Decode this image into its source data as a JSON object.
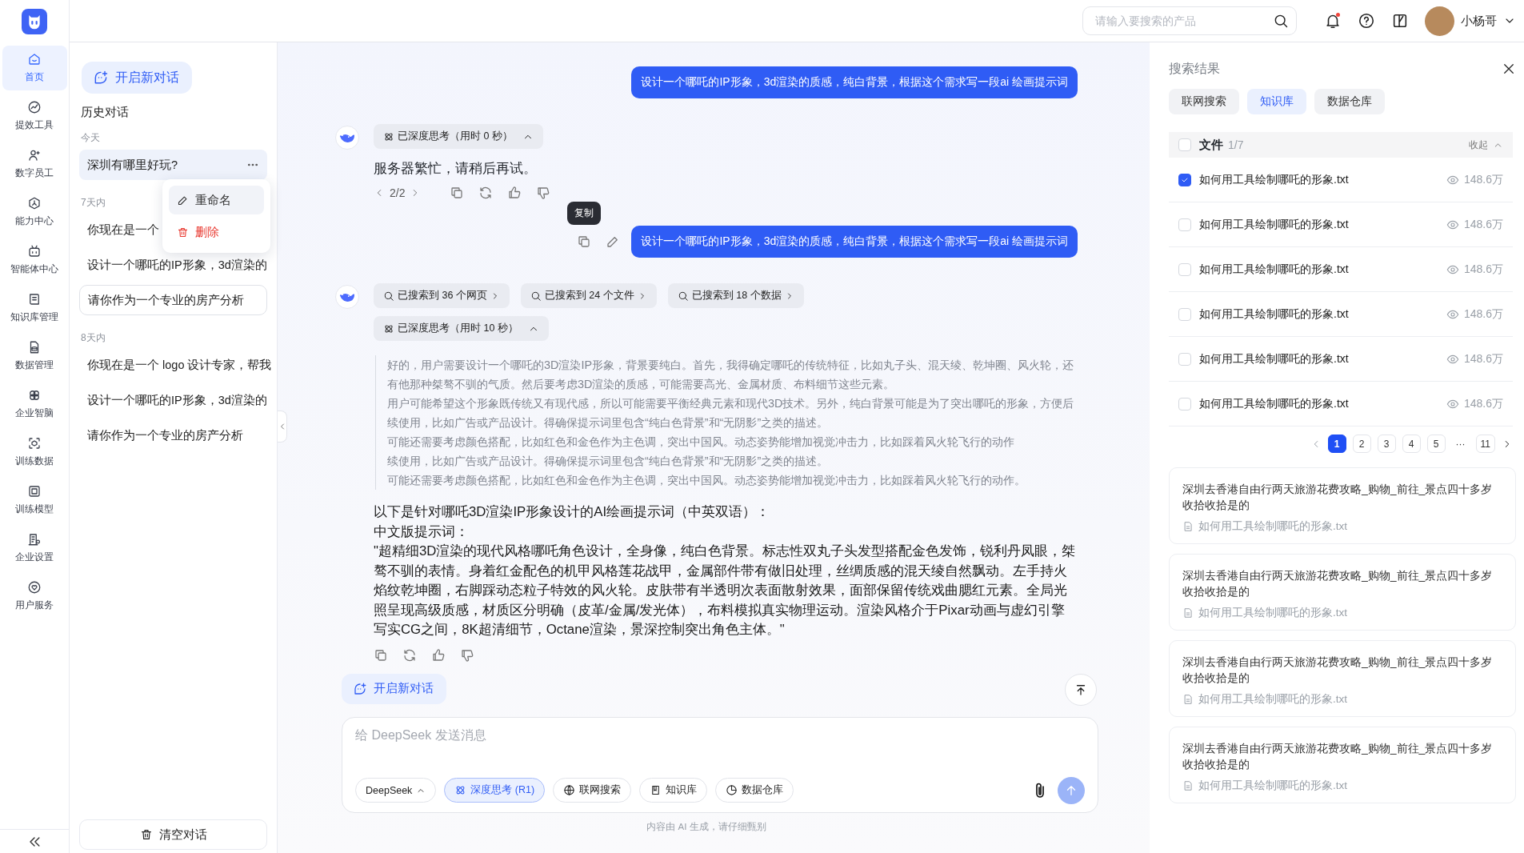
{
  "nav": {
    "items": [
      {
        "label": "首页",
        "selected": true
      },
      {
        "label": "提效工具",
        "selected": false
      },
      {
        "label": "数字员工",
        "selected": false
      },
      {
        "label": "能力中心",
        "selected": false
      },
      {
        "label": "智能体中心",
        "selected": false
      },
      {
        "label": "知识库管理",
        "selected": false
      },
      {
        "label": "数据管理",
        "selected": false
      },
      {
        "label": "企业智脑",
        "selected": false
      },
      {
        "label": "训练数据",
        "selected": false
      },
      {
        "label": "训练模型",
        "selected": false
      },
      {
        "label": "企业设置",
        "selected": false
      },
      {
        "label": "用户服务",
        "selected": false
      }
    ]
  },
  "header": {
    "search": {
      "placeholder": "请输入要搜索的产品"
    },
    "notifications": {
      "unread": true
    },
    "user": {
      "name": "小杨哥"
    }
  },
  "history": {
    "new_chat": "开启新对话",
    "title": "历史对话",
    "groups": [
      {
        "label": "今天",
        "items": [
          {
            "kind": "item",
            "text": "深圳有哪里好玩?",
            "selected": true
          }
        ]
      },
      {
        "label": "7天内",
        "items": [
          {
            "kind": "item",
            "text": "你现在是一个",
            "selected": false
          },
          {
            "kind": "item",
            "text": "设计一个哪吒的IP形象，3d渲染的",
            "selected": false
          },
          {
            "kind": "editing",
            "text": "请你作为一个专业的房产分析",
            "selected": false
          }
        ]
      },
      {
        "label": "8天内",
        "items": [
          {
            "kind": "item",
            "text": "你现在是一个 logo 设计专家，帮我",
            "selected": false
          },
          {
            "kind": "item",
            "text": "设计一个哪吒的IP形象，3d渲染的",
            "selected": false
          },
          {
            "kind": "item",
            "text": "请你作为一个专业的房产分析",
            "selected": false
          }
        ]
      }
    ],
    "context_menu": [
      {
        "kind": "rename",
        "label": "重命名",
        "selected": true
      },
      {
        "kind": "delete",
        "label": "删除",
        "selected": false
      }
    ],
    "clear": "清空对话"
  },
  "chat": {
    "messages": [
      {
        "kind": "user",
        "text": "设计一个哪吒的IP形象，3d渲染的质感，纯白背景，根据这个需求写一段ai 绘画提示词"
      },
      {
        "kind": "assistant",
        "thinking": {
          "label": "已深度思考（用时 0 秒）",
          "expanded": true
        },
        "text": "服务器繁忙，请稍后再试。",
        "pager": "2/2"
      },
      {
        "kind": "user",
        "text": "设计一个哪吒的IP形象，3d渲染的质感，纯白背景，根据这个需求写一段ai 绘画提示词",
        "tooltip": "复制"
      },
      {
        "kind": "assistant",
        "searches": [
          "已搜索到 36 个网页",
          "已搜索到 24 个文件",
          "已搜索到 18 个数据"
        ],
        "thinking": {
          "label": "已深度思考（用时 10 秒）",
          "expanded": true,
          "paragraphs": [
            "好的，用户需要设计一个哪吒的3D渲染IP形象，背景要纯白。首先，我得确定哪吒的传统特征，比如丸子头、混天绫、乾坤圈、风火轮，还有他那种桀骜不驯的气质。然后要考虑3D渲染的质感，可能需要高光、金属材质、布料细节这些元素。",
            "用户可能希望这个形象既传统又有现代感，所以可能需要平衡经典元素和现代3D技术。另外，纯白背景可能是为了突出哪吒的形象，方便后续使用，比如广告或产品设计。得确保提示词里包含“纯白色背景”和“无阴影”之类的描述。",
            "可能还需要考虑颜色搭配，比如红色和金色作为主色调，突出中国风。动态姿势能增加视觉冲击力，比如踩着风火轮飞行的动作",
            "续使用，比如广告或产品设计。得确保提示词里包含“纯白色背景”和“无阴影”之类的描述。",
            "可能还需要考虑颜色搭配，比如红色和金色作为主色调，突出中国风。动态姿势能增加视觉冲击力，比如踩着风火轮飞行的动作。"
          ]
        },
        "answer": [
          "以下是针对哪吒3D渲染IP形象设计的AI绘画提示词（中英双语）：",
          "中文版提示词：",
          "\"超精细3D渲染的现代风格哪吒角色设计，全身像，纯白色背景。标志性双丸子头发型搭配金色发饰，锐利丹凤眼，桀骜不驯的表情。身着红金配色的机甲风格莲花战甲，金属部件带有做旧处理，丝绸质感的混天绫自然飘动。左手持火焰纹乾坤圈，右脚踩动态粒子特效的风火轮。皮肤带有半透明次表面散射效果，面部保留传统戏曲腮红元素。全局光照呈现高级质感，材质区分明确（皮革/金属/发光体），布料模拟真实物理运动。渲染风格介于Pixar动画与虚幻引擎写实CG之间，8K超清细节，Octane渲染，景深控制突出角色主体。\""
        ]
      }
    ],
    "new_chat": "开启新对话",
    "composer": {
      "placeholder": "给 DeepSeek 发送消息",
      "tools": [
        {
          "kind": "model",
          "label": "DeepSeek",
          "on": false
        },
        {
          "kind": "think",
          "label": "深度思考 (R1)",
          "on": true
        },
        {
          "kind": "web",
          "label": "联网搜索",
          "on": false
        },
        {
          "kind": "kb",
          "label": "知识库",
          "on": false
        },
        {
          "kind": "db",
          "label": "数据仓库",
          "on": false
        }
      ],
      "send": {
        "disabled": true
      }
    },
    "disclaimer": "内容由 AI 生成，请仔细甄别"
  },
  "results_panel": {
    "title": "搜索结果",
    "tabs": [
      {
        "label": "联网搜索",
        "selected": false
      },
      {
        "label": "知识库",
        "selected": true
      },
      {
        "label": "数据仓库",
        "selected": false
      }
    ],
    "files": {
      "label": "文件",
      "count": "1/7",
      "checked": false,
      "collapse": "收起",
      "expanded": true,
      "items": [
        {
          "name": "如何用工具绘制哪吒的形象.txt",
          "views": "148.6万",
          "checked": true
        },
        {
          "name": "如何用工具绘制哪吒的形象.txt",
          "views": "148.6万",
          "checked": false
        },
        {
          "name": "如何用工具绘制哪吒的形象.txt",
          "views": "148.6万",
          "checked": false
        },
        {
          "name": "如何用工具绘制哪吒的形象.txt",
          "views": "148.6万",
          "checked": false
        },
        {
          "name": "如何用工具绘制哪吒的形象.txt",
          "views": "148.6万",
          "checked": false
        },
        {
          "name": "如何用工具绘制哪吒的形象.txt",
          "views": "148.6万",
          "checked": false
        }
      ]
    },
    "pagination": [
      {
        "kind": "page",
        "label": "1",
        "selected": true
      },
      {
        "kind": "page",
        "label": "2",
        "selected": false
      },
      {
        "kind": "page",
        "label": "3",
        "selected": false
      },
      {
        "kind": "page",
        "label": "4",
        "selected": false
      },
      {
        "kind": "page",
        "label": "5",
        "selected": false
      },
      {
        "kind": "ellipsis",
        "label": "···"
      },
      {
        "kind": "page",
        "label": "11",
        "selected": false
      }
    ],
    "results": [
      {
        "title": "深圳去香港自由行两天旅游花费攻略_购物_前往_景点四十多岁收拾收拾是的",
        "file": "如何用工具绘制哪吒的形象.txt"
      },
      {
        "title": "深圳去香港自由行两天旅游花费攻略_购物_前往_景点四十多岁收拾收拾是的",
        "file": "如何用工具绘制哪吒的形象.txt"
      },
      {
        "title": "深圳去香港自由行两天旅游花费攻略_购物_前往_景点四十多岁收拾收拾是的",
        "file": "如何用工具绘制哪吒的形象.txt"
      },
      {
        "title": "深圳去香港自由行两天旅游花费攻略_购物_前往_景点四十多岁收拾收拾是的",
        "file": "如何用工具绘制哪吒的形象.txt"
      }
    ]
  }
}
